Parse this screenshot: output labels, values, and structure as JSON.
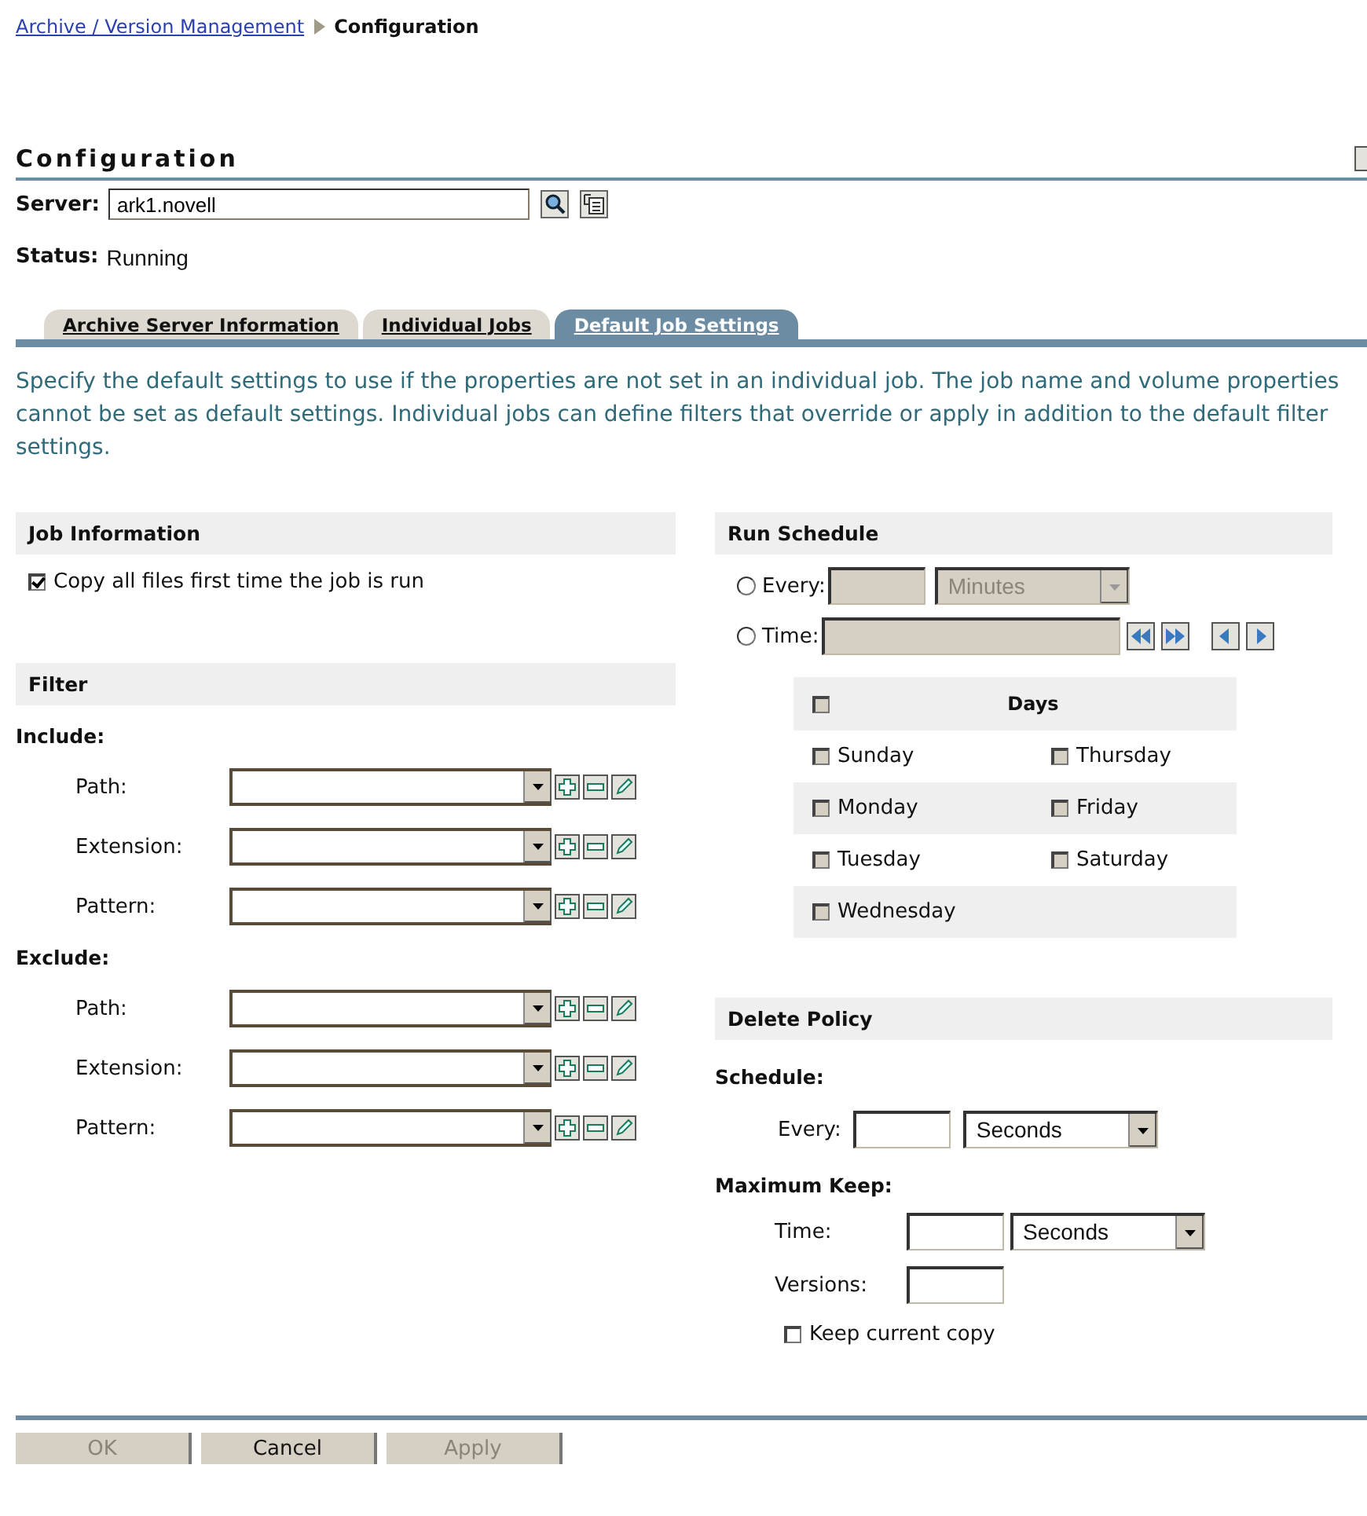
{
  "breadcrumb": {
    "link": "Archive / Version Management",
    "current": "Configuration"
  },
  "title": "Configuration",
  "server": {
    "label": "Server:",
    "value": "ark1.novell"
  },
  "status": {
    "label": "Status:",
    "value": "Running"
  },
  "tabs": [
    {
      "label": "Archive Server Information",
      "selected": false
    },
    {
      "label": "Individual Jobs",
      "selected": false
    },
    {
      "label": "Default Job Settings",
      "selected": true
    }
  ],
  "description": "Specify the default settings to use if the properties are not set in an individual job. The job name and volume properties cannot be set as default settings. Individual jobs can define filters that override or apply in addition to the default filter settings.",
  "job_information": {
    "title": "Job Information",
    "options": [
      {
        "label": "Copy all files first time the job is run",
        "checked": true
      }
    ]
  },
  "filter": {
    "title": "Filter",
    "groups": [
      {
        "label": "Include:",
        "rows": [
          {
            "label": "Path:"
          },
          {
            "label": "Extension:"
          },
          {
            "label": "Pattern:"
          }
        ]
      },
      {
        "label": "Exclude:",
        "rows": [
          {
            "label": "Path:"
          },
          {
            "label": "Extension:"
          },
          {
            "label": "Pattern:"
          }
        ]
      }
    ]
  },
  "run_schedule": {
    "title": "Run Schedule",
    "every": {
      "label": "Every:",
      "selected": false,
      "unit": "Minutes",
      "disabled": true
    },
    "time": {
      "label": "Time:",
      "selected": false,
      "disabled": true
    },
    "days": {
      "title": "Days",
      "all_checked": false,
      "items": [
        {
          "label": "Sunday",
          "checked": false
        },
        {
          "label": "Thursday",
          "checked": false
        },
        {
          "label": "Monday",
          "checked": false
        },
        {
          "label": "Friday",
          "checked": false
        },
        {
          "label": "Tuesday",
          "checked": false
        },
        {
          "label": "Saturday",
          "checked": false
        },
        {
          "label": "Wednesday",
          "checked": false
        }
      ]
    }
  },
  "delete_policy": {
    "title": "Delete Policy",
    "schedule_label": "Schedule:",
    "every": {
      "label": "Every:",
      "unit": "Seconds"
    },
    "maximum_keep_label": "Maximum Keep:",
    "time": {
      "label": "Time:",
      "unit": "Seconds"
    },
    "versions": {
      "label": "Versions:"
    },
    "keep_current": {
      "label": "Keep current copy",
      "checked": false
    }
  },
  "buttons": [
    {
      "label": "OK",
      "disabled": true
    },
    {
      "label": "Cancel",
      "disabled": false
    },
    {
      "label": "Apply",
      "disabled": true
    }
  ]
}
